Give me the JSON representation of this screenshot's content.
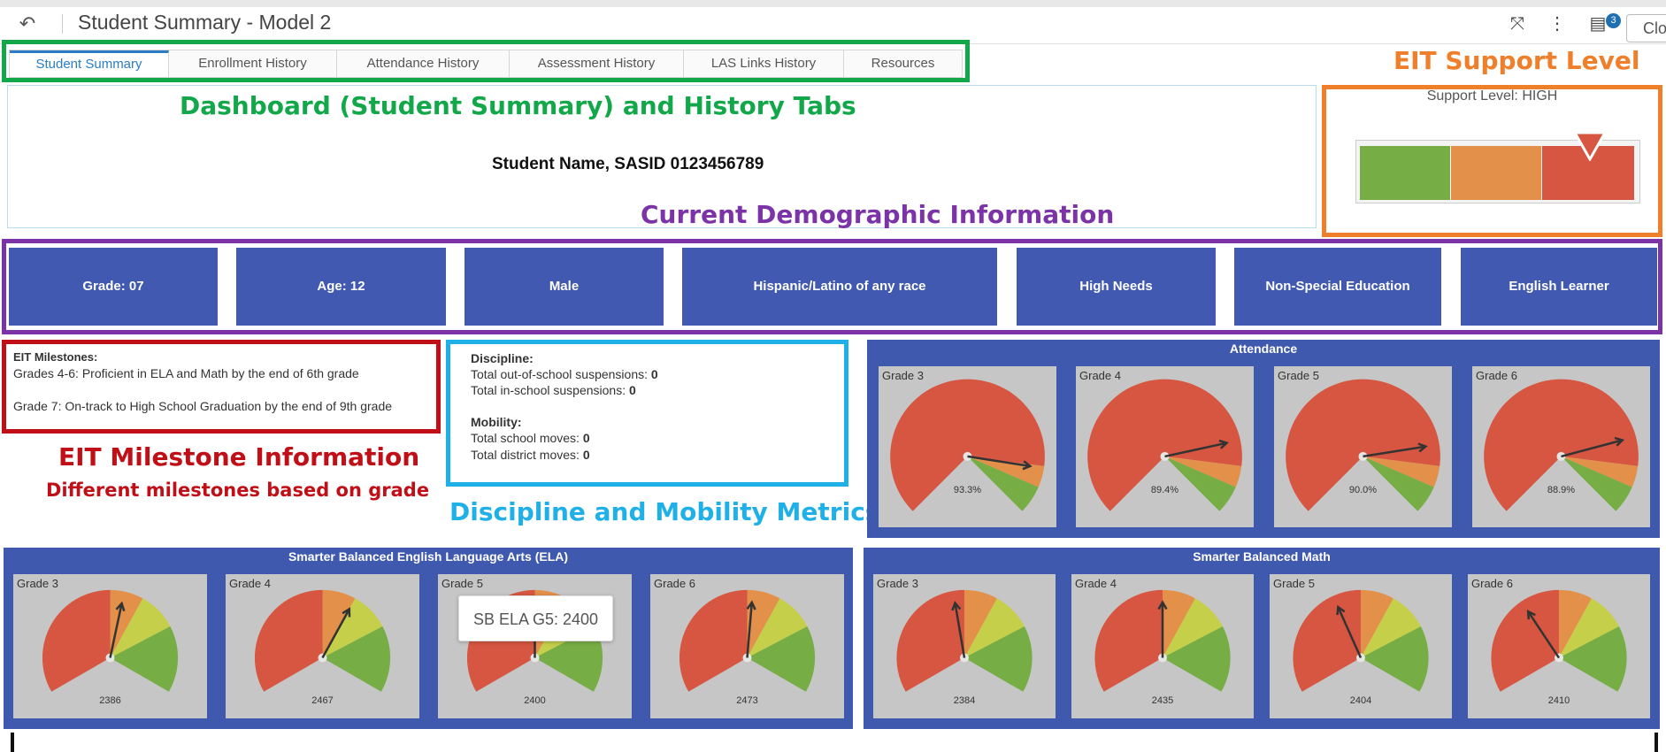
{
  "header": {
    "back_icon": "↶",
    "title": "Student Summary - Model 2",
    "expand_icon": "⤧",
    "more_icon": "⋮",
    "notes_icon": "▤",
    "notification_count": "3",
    "close_label": "Clo"
  },
  "tabs": [
    {
      "label": "Student Summary",
      "active": true
    },
    {
      "label": "Enrollment History"
    },
    {
      "label": "Attendance History"
    },
    {
      "label": "Assessment History"
    },
    {
      "label": "LAS Links History"
    },
    {
      "label": "Resources"
    }
  ],
  "annotations": {
    "tabs_note": "Dashboard (Student Summary) and History Tabs",
    "support_note": "EIT Support Level",
    "demo_note": "Current Demographic Information",
    "milestone_note": "EIT Milestone Information",
    "milestone_sub": "Different milestones based on grade",
    "discipline_note": "Discipline and Mobility Metrics"
  },
  "student": {
    "name_line": "Student Name, SASID 0123456789"
  },
  "support": {
    "label": "Support Level: HIGH",
    "level": "high"
  },
  "demographics": [
    "Grade: 07",
    "Age: 12",
    "Male",
    "Hispanic/Latino of any race",
    "High Needs",
    "Non-Special Education",
    "English Learner"
  ],
  "milestones": {
    "heading": "EIT Milestones:",
    "line1": "Grades 4-6: Proficient in ELA and Math by the end of 6th grade",
    "line2": "Grade 7: On-track to High School Graduation by the end of 9th grade"
  },
  "discipline": {
    "heading": "Discipline:",
    "oss_label": "Total out-of-school suspensions: ",
    "oss_value": "0",
    "iss_label": "Total in-school suspensions: ",
    "iss_value": "0",
    "mobility_heading": "Mobility:",
    "school_moves_label": "Total school moves: ",
    "school_moves_value": "0",
    "district_moves_label": "Total district moves: ",
    "district_moves_value": "0"
  },
  "attendance": {
    "title": "Attendance",
    "gauges": [
      {
        "grade": "Grade 3",
        "label": "93.3%",
        "value": 93.3
      },
      {
        "grade": "Grade 4",
        "label": "89.4%",
        "value": 89.4
      },
      {
        "grade": "Grade 5",
        "label": "90.0%",
        "value": 90.0
      },
      {
        "grade": "Grade 6",
        "label": "88.9%",
        "value": 88.9
      }
    ]
  },
  "ela": {
    "title": "Smarter Balanced English Language Arts (ELA)",
    "gauges": [
      {
        "grade": "Grade 3",
        "label": "2386",
        "fraction": 0.55
      },
      {
        "grade": "Grade 4",
        "label": "2467",
        "fraction": 0.62
      },
      {
        "grade": "Grade 5",
        "label": "2400",
        "fraction": 0.5
      },
      {
        "grade": "Grade 6",
        "label": "2473",
        "fraction": 0.52
      }
    ],
    "tooltip": "SB ELA G5:  2400"
  },
  "math": {
    "title": "Smarter Balanced Math",
    "gauges": [
      {
        "grade": "Grade 3",
        "label": "2384",
        "fraction": 0.46
      },
      {
        "grade": "Grade 4",
        "label": "2435",
        "fraction": 0.5
      },
      {
        "grade": "Grade 5",
        "label": "2404",
        "fraction": 0.4
      },
      {
        "grade": "Grade 6",
        "label": "2410",
        "fraction": 0.36
      }
    ]
  },
  "colors": {
    "red": "#d65641",
    "orange": "#e3904a",
    "yellow": "#c5cf4a",
    "green": "#77ad45",
    "panel": "#3f59ae"
  }
}
